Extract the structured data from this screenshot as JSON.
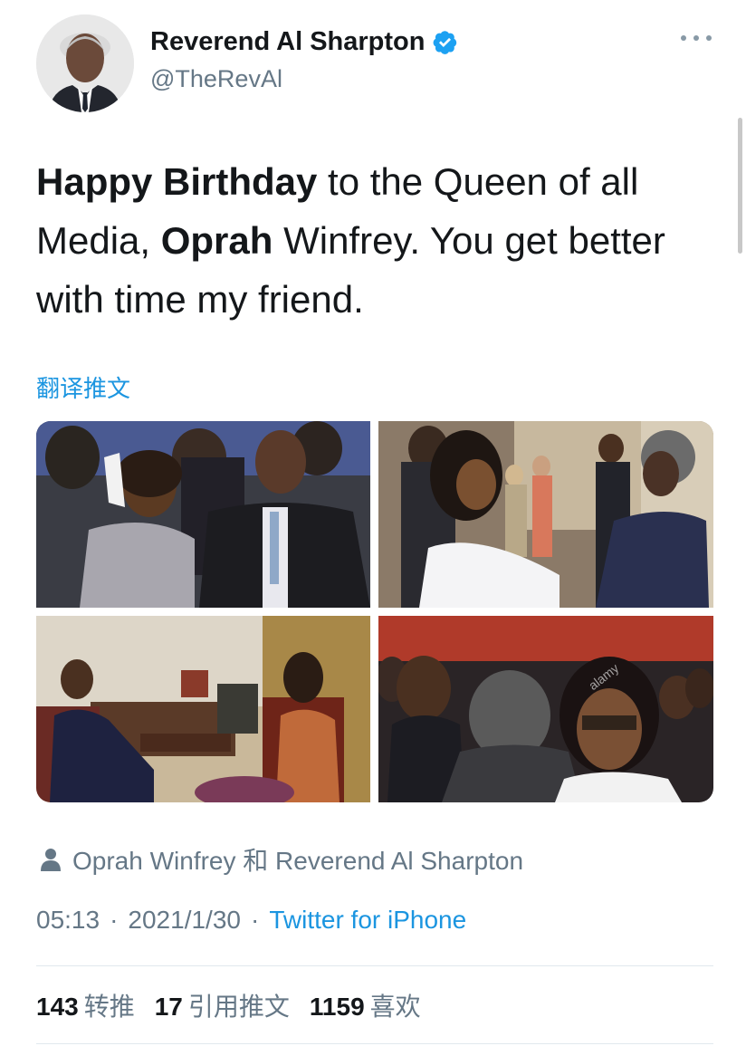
{
  "author": {
    "display_name": "Reverend Al Sharpton",
    "handle": "@TheRevAl",
    "verified": true,
    "avatar_icon": "profile-photo"
  },
  "tweet": {
    "segments": [
      {
        "text": "Happy Birthday",
        "bold": true
      },
      {
        "text": " to the Queen of all Media, ",
        "bold": false
      },
      {
        "text": "Oprah",
        "bold": true
      },
      {
        "text": " Winfrey. You get better with time my friend.",
        "bold": false
      }
    ],
    "translate_label": "翻译推文"
  },
  "photos": [
    {
      "name": "photo-clapping-event"
    },
    {
      "name": "photo-greeting-hallway"
    },
    {
      "name": "photo-interview-living-room"
    },
    {
      "name": "photo-premiere-crowd",
      "watermark": "alamy"
    }
  ],
  "tagged": {
    "icon": "person-icon",
    "text": "Oprah Winfrey 和 Reverend Al Sharpton"
  },
  "meta": {
    "time": "05:13",
    "date": "2021/1/30",
    "separator": "·",
    "source": "Twitter for iPhone"
  },
  "stats": {
    "retweets_count": "143",
    "retweets_label": "转推",
    "quotes_count": "17",
    "quotes_label": "引用推文",
    "likes_count": "1159",
    "likes_label": "喜欢"
  },
  "colors": {
    "link": "#1b95e0",
    "secondary_text": "#657786",
    "primary_text": "#14171a",
    "verified_badge": "#1da1f2"
  }
}
